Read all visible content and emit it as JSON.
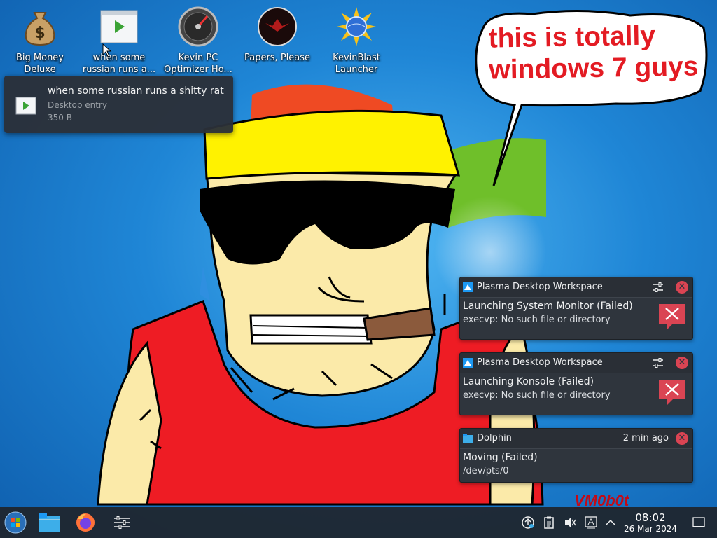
{
  "desktop": {
    "icons": [
      {
        "label": "Big Money Deluxe",
        "icon": "money-bag-icon"
      },
      {
        "label": "when some russian runs a...",
        "icon": "play-icon"
      },
      {
        "label": "Kevin PC Optimizer Ho...",
        "icon": "gauge-icon"
      },
      {
        "label": "Papers, Please",
        "icon": "eagle-emblem-icon"
      },
      {
        "label": "KevinBlast Launcher",
        "icon": "globe-icon"
      }
    ]
  },
  "tooltip": {
    "title": "when some russian runs a shitty rat",
    "type": "Desktop entry",
    "size": "350 B"
  },
  "wallpaper": {
    "speech_bubble": "this is totally\nwindows 7 guys",
    "signature": "VM0b0t"
  },
  "notifications": [
    {
      "app": "Plasma Desktop Workspace",
      "title": "Launching System Monitor (Failed)",
      "body": "execvp: No such file or directory",
      "icon": "error-icon"
    },
    {
      "app": "Plasma Desktop Workspace",
      "title": "Launching Konsole (Failed)",
      "body": "execvp: No such file or directory",
      "icon": "error-icon"
    },
    {
      "app": "Dolphin",
      "time": "2 min ago",
      "title": "Moving (Failed)",
      "body": "/dev/pts/0",
      "icon": "folder-icon"
    }
  ],
  "taskbar": {
    "launchers": [
      "start-menu-icon",
      "file-manager-icon",
      "firefox-icon",
      "settings-sliders-icon"
    ],
    "tray": [
      "updates-icon",
      "clipboard-icon",
      "volume-muted-icon",
      "input-method-icon",
      "expand-tray-icon"
    ],
    "clock_time": "08:02",
    "clock_date": "26 Mar 2024"
  },
  "colors": {
    "notification_bg": "#2f353d",
    "close_red": "#da4453",
    "bubble_text": "#e31b23"
  }
}
